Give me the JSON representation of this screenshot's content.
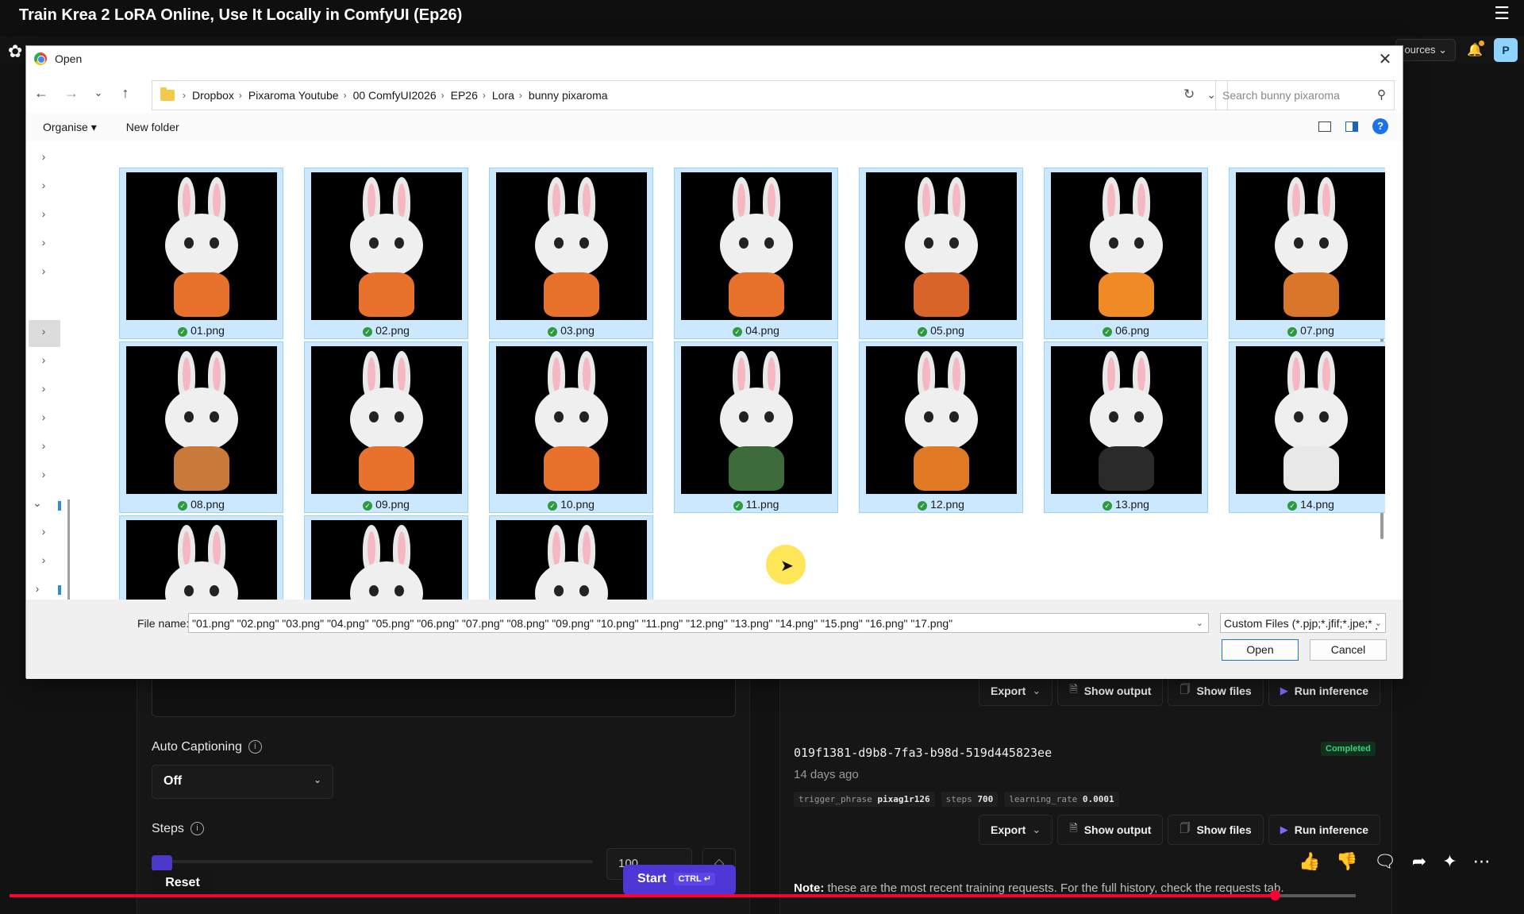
{
  "video": {
    "title": "Train Krea 2 LoRA Online, Use It Locally in ComfyUI (Ep26)"
  },
  "app": {
    "resources_label": "ources",
    "profile_initial": "P",
    "auto_captioning": {
      "label": "Auto Captioning",
      "value": "Off"
    },
    "steps": {
      "label": "Steps",
      "value": "100"
    },
    "reset_label": "Reset",
    "start_label": "Start",
    "start_shortcut": "CTRL ↵",
    "actions": {
      "export": "Export",
      "show_output": "Show output",
      "show_files": "Show files",
      "run_inference": "Run inference"
    },
    "job": {
      "id": "019f1381-d9b8-7fa3-b98d-519d445823ee",
      "time": "14 days ago",
      "status": "Completed",
      "params": [
        {
          "key": "trigger_phrase",
          "value": "pixag1r126"
        },
        {
          "key": "steps",
          "value": "700"
        },
        {
          "key": "learning_rate",
          "value": "0.0001"
        }
      ]
    },
    "note_prefix": "Note:",
    "note_text": "these are the most recent training requests. For the full history, check the requests tab."
  },
  "dialog": {
    "title": "Open",
    "breadcrumbs": [
      "Dropbox",
      "Pixaroma Youtube",
      "00 ComfyUI2026",
      "EP26",
      "Lora",
      "bunny pixaroma"
    ],
    "search_placeholder": "Search bunny pixaroma",
    "toolbar": {
      "organise": "Organise ▾",
      "new_folder": "New folder"
    },
    "files": [
      {
        "name": "01.png",
        "outfit": "#e8722c"
      },
      {
        "name": "02.png",
        "outfit": "#e8722c"
      },
      {
        "name": "03.png",
        "outfit": "#e8722c"
      },
      {
        "name": "04.png",
        "outfit": "#e8722c"
      },
      {
        "name": "05.png",
        "outfit": "#d9642a"
      },
      {
        "name": "06.png",
        "outfit": "#ef8a24"
      },
      {
        "name": "07.png",
        "outfit": "#d9762a"
      },
      {
        "name": "08.png",
        "outfit": "#c97a3a"
      },
      {
        "name": "09.png",
        "outfit": "#e8722c"
      },
      {
        "name": "10.png",
        "outfit": "#e8722c"
      },
      {
        "name": "11.png",
        "outfit": "#3d6b3a"
      },
      {
        "name": "12.png",
        "outfit": "#e07a24"
      },
      {
        "name": "13.png",
        "outfit": "#2a2a2a"
      },
      {
        "name": "14.png",
        "outfit": "#e8e8e8"
      },
      {
        "name": "15.png",
        "outfit": "#e8e8e8"
      },
      {
        "name": "16.png",
        "outfit": "#e8722c"
      },
      {
        "name": "17.png",
        "outfit": "#333333"
      }
    ],
    "file_name_label": "File name:",
    "file_name_value": "\"01.png\" \"02.png\" \"03.png\" \"04.png\" \"05.png\" \"06.png\" \"07.png\" \"08.png\" \"09.png\" \"10.png\" \"11.png\" \"12.png\" \"13.png\" \"14.png\" \"15.png\" \"16.png\" \"17.png\"",
    "file_type_value": "Custom Files (*.pjp;*.jfif;*.jpe;*.p",
    "open_label": "Open",
    "cancel_label": "Cancel"
  }
}
